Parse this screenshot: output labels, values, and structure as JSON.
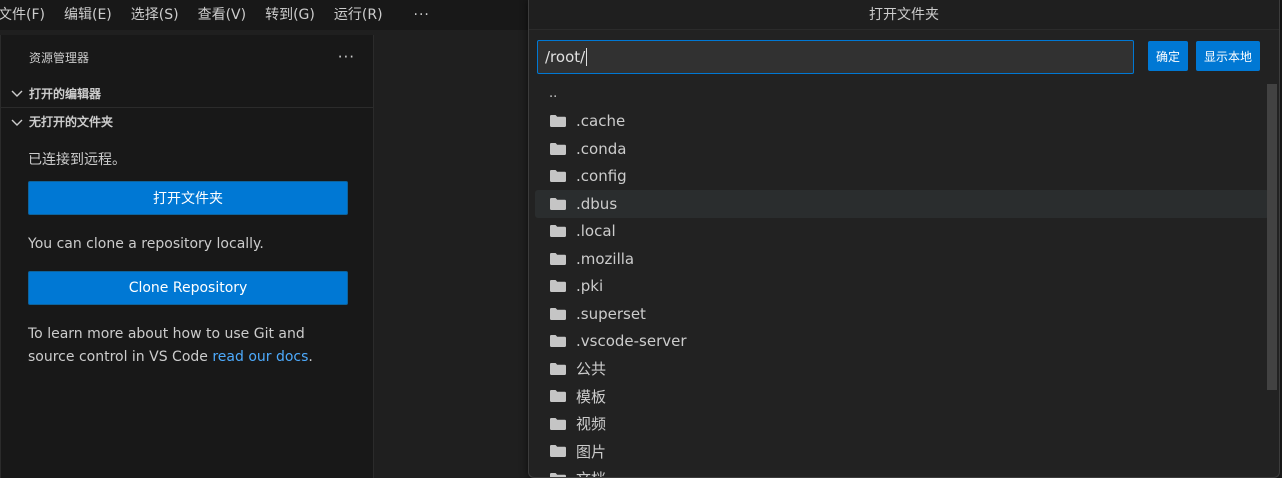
{
  "menubar": {
    "items": [
      "文件(F)",
      "编辑(E)",
      "选择(S)",
      "查看(V)",
      "转到(G)",
      "运行(R)"
    ],
    "more": "···"
  },
  "sidebar": {
    "title": "资源管理器",
    "more": "···",
    "section_open_editors": "打开的编辑器",
    "section_no_folder": "无打开的文件夹",
    "connected_text": "已连接到远程。",
    "open_folder_button": "打开文件夹",
    "clone_text": "You can clone a repository locally.",
    "clone_button": "Clone Repository",
    "learn_text_1": "To learn more about how to use Git and",
    "learn_text_2": "source control in VS Code ",
    "learn_link": "read our docs",
    "learn_period": "."
  },
  "quickpick": {
    "title": "打开文件夹",
    "input_value": "/root/",
    "ok_button": "确定",
    "show_local_button": "显示本地",
    "parent_entry": "..",
    "items": [
      ".cache",
      ".conda",
      ".config",
      ".dbus",
      ".local",
      ".mozilla",
      ".pki",
      ".superset",
      ".vscode-server",
      "公共",
      "模板",
      "视频",
      "图片",
      "文档"
    ],
    "active_item": ".dbus"
  },
  "colors": {
    "accent": "#0078d4",
    "link": "#4daafc",
    "folder_icon": "#c5c5c5"
  }
}
